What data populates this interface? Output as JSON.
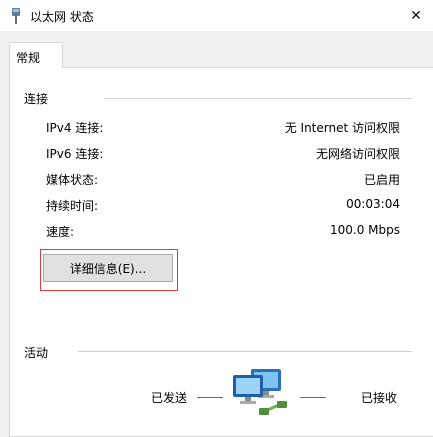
{
  "window": {
    "title": "以太网 状态",
    "close_glyph": "✕"
  },
  "tabs": [
    {
      "label": "常规",
      "selected": true
    }
  ],
  "connection": {
    "section_label": "连接",
    "rows": [
      {
        "label": "IPv4 连接:",
        "value": "无 Internet 访问权限"
      },
      {
        "label": "IPv6 连接:",
        "value": "无网络访问权限"
      },
      {
        "label": "媒体状态:",
        "value": "已启用"
      },
      {
        "label": "持续时间:",
        "value": "00:03:04"
      },
      {
        "label": "速度:",
        "value": "100.0 Mbps"
      }
    ],
    "details_button": "详细信息(E)..."
  },
  "activity": {
    "section_label": "活动",
    "sent_label": "已发送",
    "received_label": "已接收",
    "icon": "network-computers-icon"
  },
  "colors": {
    "focus_highlight": "#e03b3b",
    "window_bg": "#f0f0f0",
    "panel_bg": "#ffffff"
  }
}
